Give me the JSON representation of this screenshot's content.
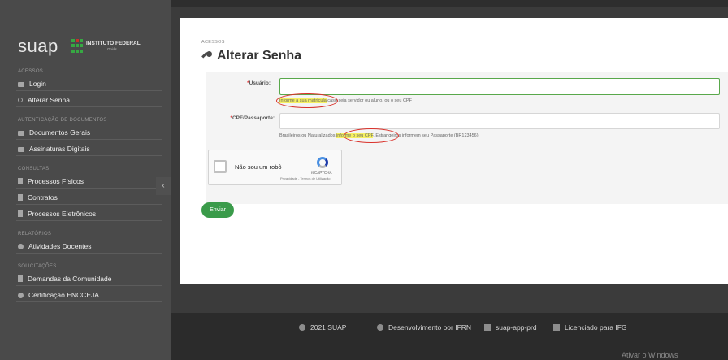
{
  "brand": {
    "name": "suap",
    "institute": "INSTITUTO FEDERAL",
    "campus": "Goiás"
  },
  "sidebar": {
    "sections": [
      {
        "title": "ACESSOS",
        "items": [
          {
            "label": "Login",
            "icon": "lock-icon"
          },
          {
            "label": "Alterar Senha",
            "icon": "key-icon"
          }
        ]
      },
      {
        "title": "AUTENTICAÇÃO DE DOCUMENTOS",
        "items": [
          {
            "label": "Documentos Gerais",
            "icon": "lock-icon"
          },
          {
            "label": "Assinaturas Digitais",
            "icon": "lock-icon"
          }
        ]
      },
      {
        "title": "CONSULTAS",
        "items": [
          {
            "label": "Processos Físicos",
            "icon": "document-icon"
          },
          {
            "label": "Contratos",
            "icon": "document-icon"
          },
          {
            "label": "Processos Eletrônicos",
            "icon": "document-icon"
          }
        ]
      },
      {
        "title": "RELATÓRIOS",
        "items": [
          {
            "label": "Atividades Docentes",
            "icon": "circle-icon"
          }
        ]
      },
      {
        "title": "SOLICITAÇÕES",
        "items": [
          {
            "label": "Demandas da Comunidade",
            "icon": "document-icon"
          },
          {
            "label": "Certificação ENCCEJA",
            "icon": "circle-icon"
          }
        ]
      }
    ],
    "collapse_glyph": "‹"
  },
  "main": {
    "breadcrumb": "ACESSOS",
    "title": "Alterar Senha",
    "form": {
      "usuario": {
        "label": "Usuário:",
        "required_mark": "*",
        "value": "",
        "help_highlight": "Informe a sua matrícula",
        "help_rest": " caso seja servidor ou aluno, ou o seu CPF"
      },
      "cpf": {
        "label": "CPF/Passaporte:",
        "required_mark": "*",
        "value": "",
        "help_before": "Brasileiros ou Naturalizados ",
        "help_highlight": "informe o seu CPF",
        "help_after": ". Estrangeiros informem seu Passaporte (BR123456)."
      },
      "recaptcha": {
        "label": "Não sou um robô",
        "brand": "reCAPTCHA",
        "terms": "Privacidade - Termos de Utilização"
      },
      "submit_label": "Enviar"
    }
  },
  "footer": {
    "items": [
      {
        "label": "2021 SUAP",
        "icon": "copyright-icon"
      },
      {
        "label": "Desenvolvimento por IFRN",
        "icon": "gear-icon"
      },
      {
        "label": "suap-app-prd",
        "icon": "server-icon"
      },
      {
        "label": "Licenciado para IFG",
        "icon": "license-icon"
      }
    ],
    "watermark": "Ativar o Windows"
  },
  "colors": {
    "sidebar_bg": "#4a4a4a",
    "accent_green": "#3a9b4a",
    "highlight_yellow": "#f5f060",
    "annotation_red": "#d9322b"
  }
}
